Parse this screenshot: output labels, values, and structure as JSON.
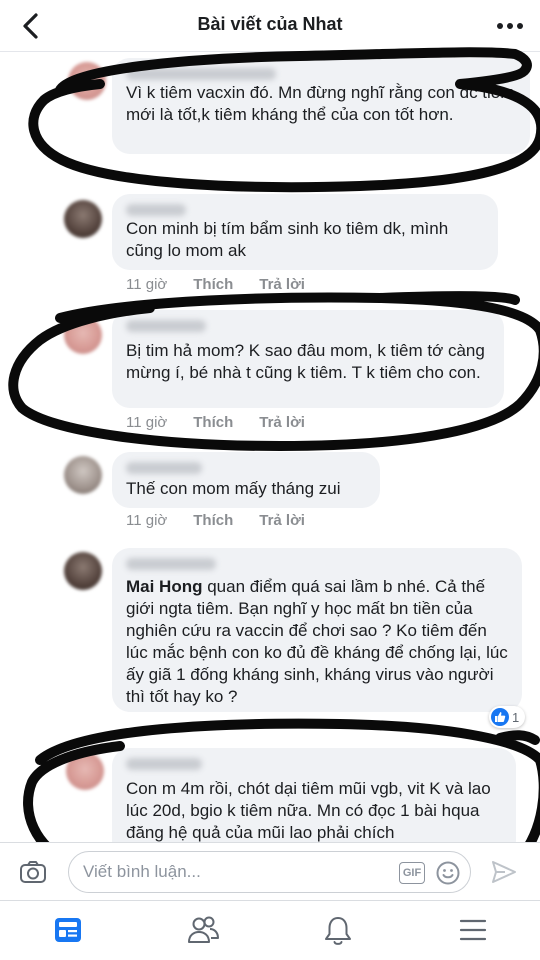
{
  "header": {
    "title": "Bài viết của Nhat",
    "back_icon": "chevron-left-icon",
    "more_icon": "more-dots-icon"
  },
  "actions": {
    "like": "Thích",
    "reply": "Trả lời"
  },
  "comments": [
    {
      "text": "Vì k tiêm vacxin đó. Mn đừng nghĩ rằng con đc tiêm mới là tốt,k tiêm kháng thể của con tốt hơn.",
      "time": ""
    },
    {
      "text": "Con minh bị tím bẩm sinh ko tiêm dk, mình cũng lo mom ak",
      "time": "11 giờ"
    },
    {
      "text": "Bị tim hả mom? K sao đâu mom, k tiêm tớ càng mừng í, bé nhà t cũng k tiêm. T k tiêm cho con.",
      "time": "11 giờ"
    },
    {
      "text": "Thế con mom mấy tháng zui",
      "time": "11 giờ"
    },
    {
      "mention": "Mai Hong",
      "text": " quan điểm quá sai lầm b nhé. Cả thế giới ngta tiêm. Bạn nghĩ y học mất bn tiền của nghiên cứu ra vaccin để chơi sao ? Ko tiêm đến lúc mắc bệnh con ko đủ đề kháng để chống lại, lúc ấy giã 1 đống kháng sinh, kháng virus vào người thì tốt hay ko ?",
      "reactions": "1"
    },
    {
      "text": "Con m 4m rồi, chót dại tiêm mũi vgb, vit K và lao lúc 20d, bgio k tiêm nữa. Mn có đọc 1 bài hqua đăng hệ quả của mũi lao phải chích"
    }
  ],
  "composer": {
    "placeholder": "Viết bình luận...",
    "gif_label": "GIF",
    "camera_icon": "camera-icon",
    "emoji_icon": "smiley-icon",
    "send_icon": "send-icon"
  },
  "tabs": [
    {
      "icon": "news-feed-icon",
      "active": true
    },
    {
      "icon": "friends-icon",
      "active": false
    },
    {
      "icon": "bell-icon",
      "active": false
    },
    {
      "icon": "menu-icon",
      "active": false
    }
  ],
  "colors": {
    "accent": "#1877f2",
    "bubble": "#f0f2f5",
    "meta": "#8a8d91",
    "ink": "#0a0a0a"
  }
}
